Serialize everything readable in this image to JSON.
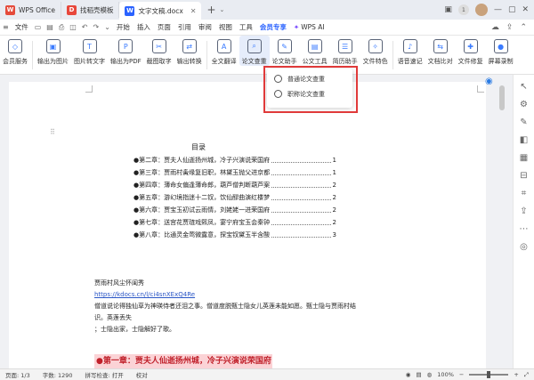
{
  "tabs": [
    {
      "label": "WPS Office",
      "icon": "wps-logo-icon",
      "color": "#e54b3b"
    },
    {
      "label": "找稻壳模板",
      "icon": "docer-icon",
      "color": "#e8473b"
    },
    {
      "label": "文字文稿.docx",
      "icon": "wps-writer-icon",
      "color": "#2a62ff"
    }
  ],
  "menubar": {
    "file": "文件",
    "items": [
      "开始",
      "插入",
      "页面",
      "引用",
      "审阅",
      "视图",
      "工具"
    ],
    "vip": "会员专享",
    "wps_ai": "WPS AI"
  },
  "ribbon": [
    "会员服务",
    "输出为图片",
    "图片转文字",
    "输出为PDF",
    "截图取字",
    "输出转换",
    "全文翻译",
    "论文查重",
    "论文助手",
    "公文工具",
    "简历助手",
    "文件特色",
    "语音速记",
    "文档比对",
    "文件修复",
    "屏幕录制"
  ],
  "dropdown": {
    "items": [
      "普通论文查重",
      "职称论文查重"
    ]
  },
  "document": {
    "toc_title": "目录",
    "toc": [
      {
        "text": "●第二章：贾夫人仙逝扬州城，冷子兴演说荣国府",
        "page": "1"
      },
      {
        "text": "●第三章：贾雨村夤缘复旧职，林黛玉抛父进京都",
        "page": "1"
      },
      {
        "text": "●第四章：薄命女偏逢薄命郎，葫芦僧判断葫芦案",
        "page": "2"
      },
      {
        "text": "●第五章：游幻境指迷十二钗，饮仙醪曲演红楼梦",
        "page": "2"
      },
      {
        "text": "●第六章：贾宝玉初试云雨情，刘姥姥一进荣国府",
        "page": "2"
      },
      {
        "text": "●第七章：送宫花贾琏戏熙凤，宴宁府宝玉会秦钟",
        "page": "2"
      },
      {
        "text": "●第八章：比通灵金莺微露意，探宝钗黛玉半含酸",
        "page": "3"
      }
    ],
    "para1": "贾雨村风尘怀闺秀",
    "link": "https://kdocs.cn/l/ci4snXExQ4Re",
    "para2": "僧道说论得独仙草为神瑛侍者还泪之事。僧道度脱甄士隐女儿英莲未能如愿。甄士隐与贾雨村结识。英莲丢失",
    "para3": "；士隐出家，士隐解好了歌。",
    "heading": "●第一章：贾夫人仙逝扬州城，冷子兴演说荣国府"
  },
  "status": {
    "page": "页面: 1/3",
    "words": "字数: 1290",
    "spell": "拼写检查: 打开",
    "proof": "校对",
    "zoom": "100%"
  }
}
